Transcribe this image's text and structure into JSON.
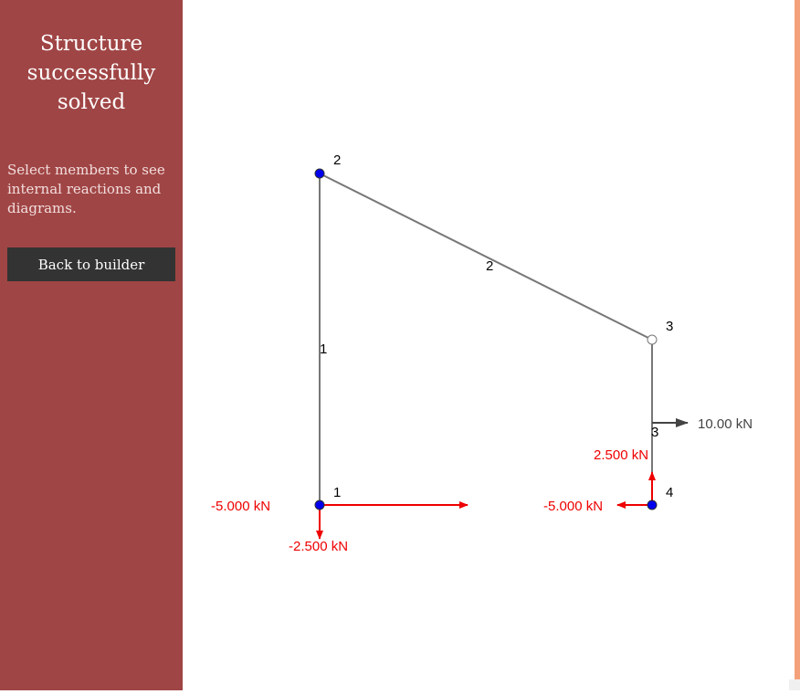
{
  "sidebar": {
    "title": "Structure successfully solved",
    "hint": "Select members to see internal reactions and diagrams.",
    "back_button": "Back to builder"
  },
  "colors": {
    "sidebar": "#a04545",
    "button": "#333333",
    "accent": "#f4a07a",
    "member": "#777777",
    "fixed_node": "#0000ee",
    "reaction": "#ee0000",
    "applied_load": "#444444"
  },
  "structure": {
    "nodes": [
      {
        "id": "1",
        "label": "1",
        "support": "fixed"
      },
      {
        "id": "2",
        "label": "2",
        "support": "fixed"
      },
      {
        "id": "3",
        "label": "3",
        "support": "hinge"
      },
      {
        "id": "4",
        "label": "4",
        "support": "fixed"
      }
    ],
    "members": [
      {
        "id": "1",
        "label": "1",
        "from": "1",
        "to": "2"
      },
      {
        "id": "2",
        "label": "2",
        "from": "2",
        "to": "3"
      },
      {
        "id": "3",
        "label": "3",
        "from": "3",
        "to": "4"
      }
    ],
    "applied_loads": [
      {
        "label": "10.00 kN",
        "on": "member 3",
        "direction": "right"
      }
    ],
    "reactions": [
      {
        "node": "1",
        "label": "-5.000 kN",
        "direction": "left"
      },
      {
        "node": "1",
        "label": "-2.500 kN",
        "direction": "down"
      },
      {
        "node": "4",
        "label": "-5.000 kN",
        "direction": "left"
      },
      {
        "node": "4",
        "label": "2.500 kN",
        "direction": "up"
      }
    ]
  }
}
